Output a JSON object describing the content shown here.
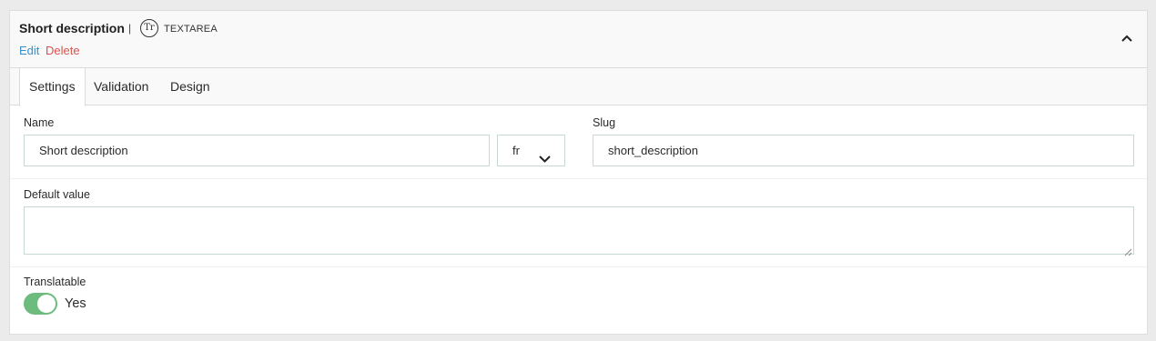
{
  "header": {
    "title": "Short description",
    "separator": "|",
    "type_icon_text": "Tr",
    "type_label": "TEXTAREA",
    "edit_label": "Edit",
    "delete_label": "Delete"
  },
  "tabs": [
    {
      "label": "Settings",
      "active": true
    },
    {
      "label": "Validation",
      "active": false
    },
    {
      "label": "Design",
      "active": false
    }
  ],
  "form": {
    "name_label": "Name",
    "name_value": "Short description",
    "language_value": "fr",
    "slug_label": "Slug",
    "slug_value": "short_description",
    "default_label": "Default value",
    "default_value": "",
    "translatable_label": "Translatable",
    "translatable_state": "Yes",
    "translatable_on": true
  },
  "colors": {
    "link": "#3a8fc9",
    "danger": "#d9534f",
    "toggle_on": "#6dbb7d",
    "input_border": "#c6d9d3"
  },
  "icons": {
    "type": "text-type-icon",
    "collapse": "chevron-up-icon",
    "language": "chevron-down-icon",
    "resize": "resize-grip-icon"
  }
}
